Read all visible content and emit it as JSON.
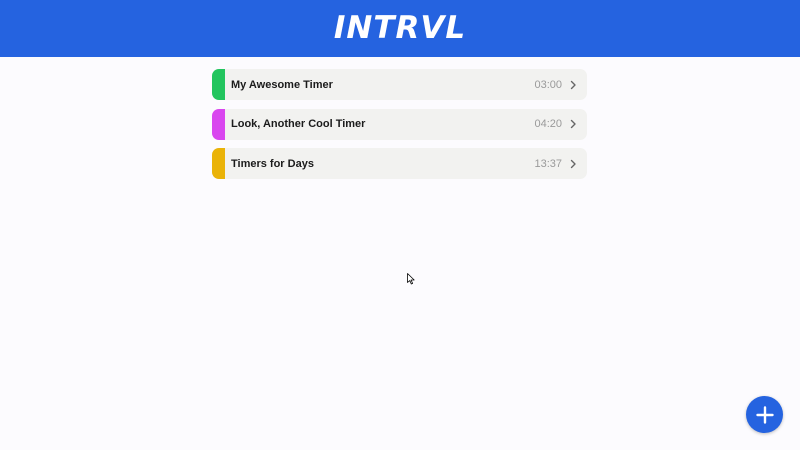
{
  "app": {
    "title": "INTRVL"
  },
  "colors": {
    "brand": "#2563e0",
    "background": "#fcfbfe",
    "item_background": "#f2f2f0"
  },
  "timers": [
    {
      "name": "My Awesome Timer",
      "duration": "03:00",
      "color": "#22c55e"
    },
    {
      "name": "Look, Another Cool Timer",
      "duration": "04:20",
      "color": "#d946ef"
    },
    {
      "name": "Timers for Days",
      "duration": "13:37",
      "color": "#eab308"
    }
  ],
  "fab": {
    "icon": "plus-icon"
  }
}
